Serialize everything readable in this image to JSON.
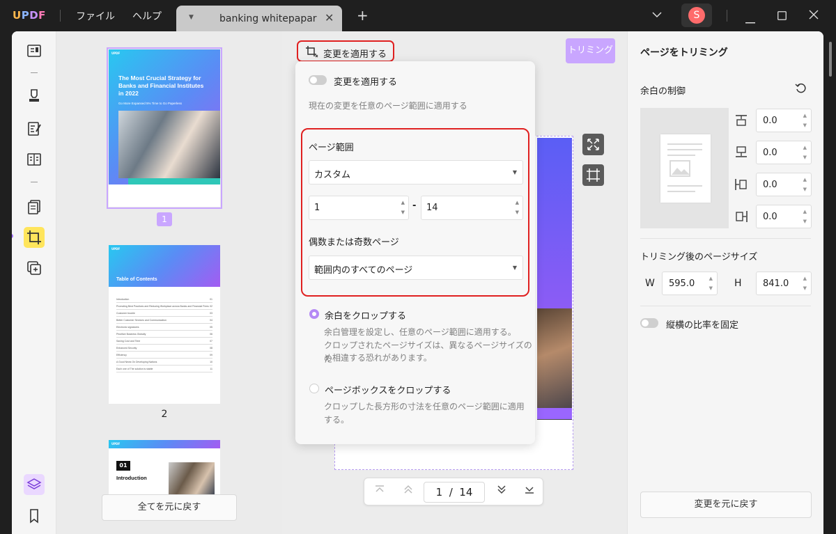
{
  "app": {
    "logo": "UPDF"
  },
  "menu": {
    "file": "ファイル",
    "help": "ヘルプ"
  },
  "tab": {
    "name": "banking whitepapar"
  },
  "user": {
    "initial": "S"
  },
  "thumbnails": {
    "page1": {
      "title": "The Most Crucial Strategy for Banks and Financial Institutes in 2022",
      "subtitle": "Go More Expansed 5% Time to Go Paperless",
      "label": "1"
    },
    "page2": {
      "title": "Table of Contents",
      "label": "2",
      "toc": [
        {
          "text": "Introduction",
          "num": "01"
        },
        {
          "text": "Promoting Best Practices and Reducing Workplace across Banks and Financial Firms",
          "num": "02"
        },
        {
          "text": "Customer trouble",
          "num": "03"
        },
        {
          "text": "Better Customer Services and Communication",
          "num": "04"
        },
        {
          "text": "Electronic signatures",
          "num": "05"
        },
        {
          "text": "Prioritize Business Globally",
          "num": "06"
        },
        {
          "text": "Saving Cost and Time",
          "num": "07"
        },
        {
          "text": "Enhanced Security",
          "num": "08"
        },
        {
          "text": "Efficiency",
          "num": "09"
        },
        {
          "text": "A Good News On Developing Nations",
          "num": "10"
        },
        {
          "text": "Each one of The solution is stable",
          "num": "11"
        }
      ]
    },
    "page3": {
      "num": "01",
      "title": "Introduction"
    },
    "reset_all": "全てを元に戻す"
  },
  "toolbar": {
    "apply_label": "変更を適用する",
    "trim_label": "トリミング"
  },
  "popup": {
    "toggle_label": "変更を適用する",
    "toggle_desc": "現在の変更を任意のページ範囲に適用する",
    "range_title": "ページ範囲",
    "range_select": "カスタム",
    "range_from": "1",
    "range_dash": "-",
    "range_to": "14",
    "parity_title": "偶数または奇数ページ",
    "parity_select": "範囲内のすべてのページ",
    "opt1_label": "余白をクロップする",
    "opt1_desc1": "余白管理を設定し、任意のページ範囲に適用する。",
    "opt1_desc2": "クロップされたページサイズは、異なるページサイズのた",
    "opt1_desc3": "め相違する恐れがあります。",
    "opt2_label": "ページボックスをクロップする",
    "opt2_desc1": "クロップした長方形の寸法を任意のページ範囲に適用",
    "opt2_desc2": "する。"
  },
  "nav": {
    "current": "1",
    "sep": "/",
    "total": "14"
  },
  "right": {
    "title": "ページをトリミング",
    "margin_title": "余白の制御",
    "margin_top": "0.0",
    "margin_bottom": "0.0",
    "margin_left": "0.0",
    "margin_right": "0.0",
    "size_title": "トリミング後のページサイズ",
    "w_label": "W",
    "w_value": "595.0",
    "h_label": "H",
    "h_value": "841.0",
    "ratio_label": "縦横の比率を固定",
    "reset": "変更を元に戻す"
  }
}
